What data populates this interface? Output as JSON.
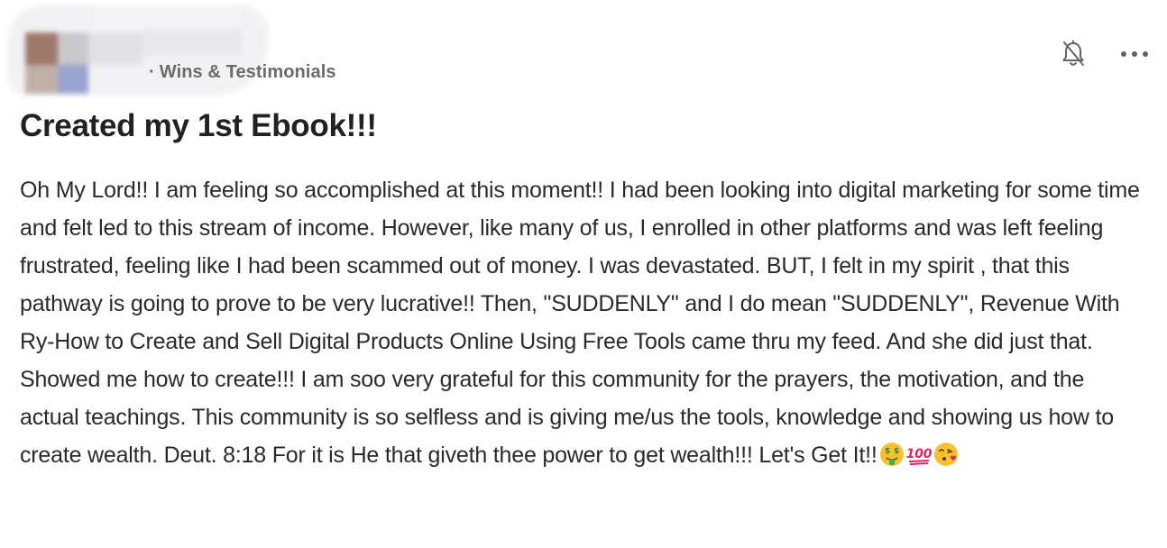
{
  "post": {
    "category_prefix": "·",
    "category": "Wins & Testimonials",
    "title": "Created my 1st Ebook!!!",
    "body": "Oh My Lord!! I am feeling so accomplished at this moment!! I had been looking into digital marketing for some time and felt led to this stream of income. However, like many of us, I enrolled in other platforms and was left feeling frustrated, feeling like I had been scammed out of money. I was devastated. BUT, I felt in my spirit , that this pathway is going to prove to be very lucrative!! Then, \"SUDDENLY\" and I do mean \"SUDDENLY\", Revenue With Ry-How to Create and Sell Digital Products Online Using Free Tools came thru my feed. And she did just that. Showed me how to create!!! I am soo very grateful for this community for the prayers, the motivation, and the actual teachings. This community is so selfless and is giving me/us the tools, knowledge and showing us how to create wealth. Deut. 8:18 For it is He that giveth thee power to get wealth!!! Let's Get It!!",
    "emojis": [
      "money-mouth-face",
      "hundred-points",
      "face-blowing-kiss"
    ]
  },
  "icons": {
    "bell": "bell-off-icon",
    "more": "more-horizontal-icon"
  },
  "colors": {
    "text": "#202124",
    "muted": "#6b6b6b",
    "icon": "#5f6368"
  }
}
